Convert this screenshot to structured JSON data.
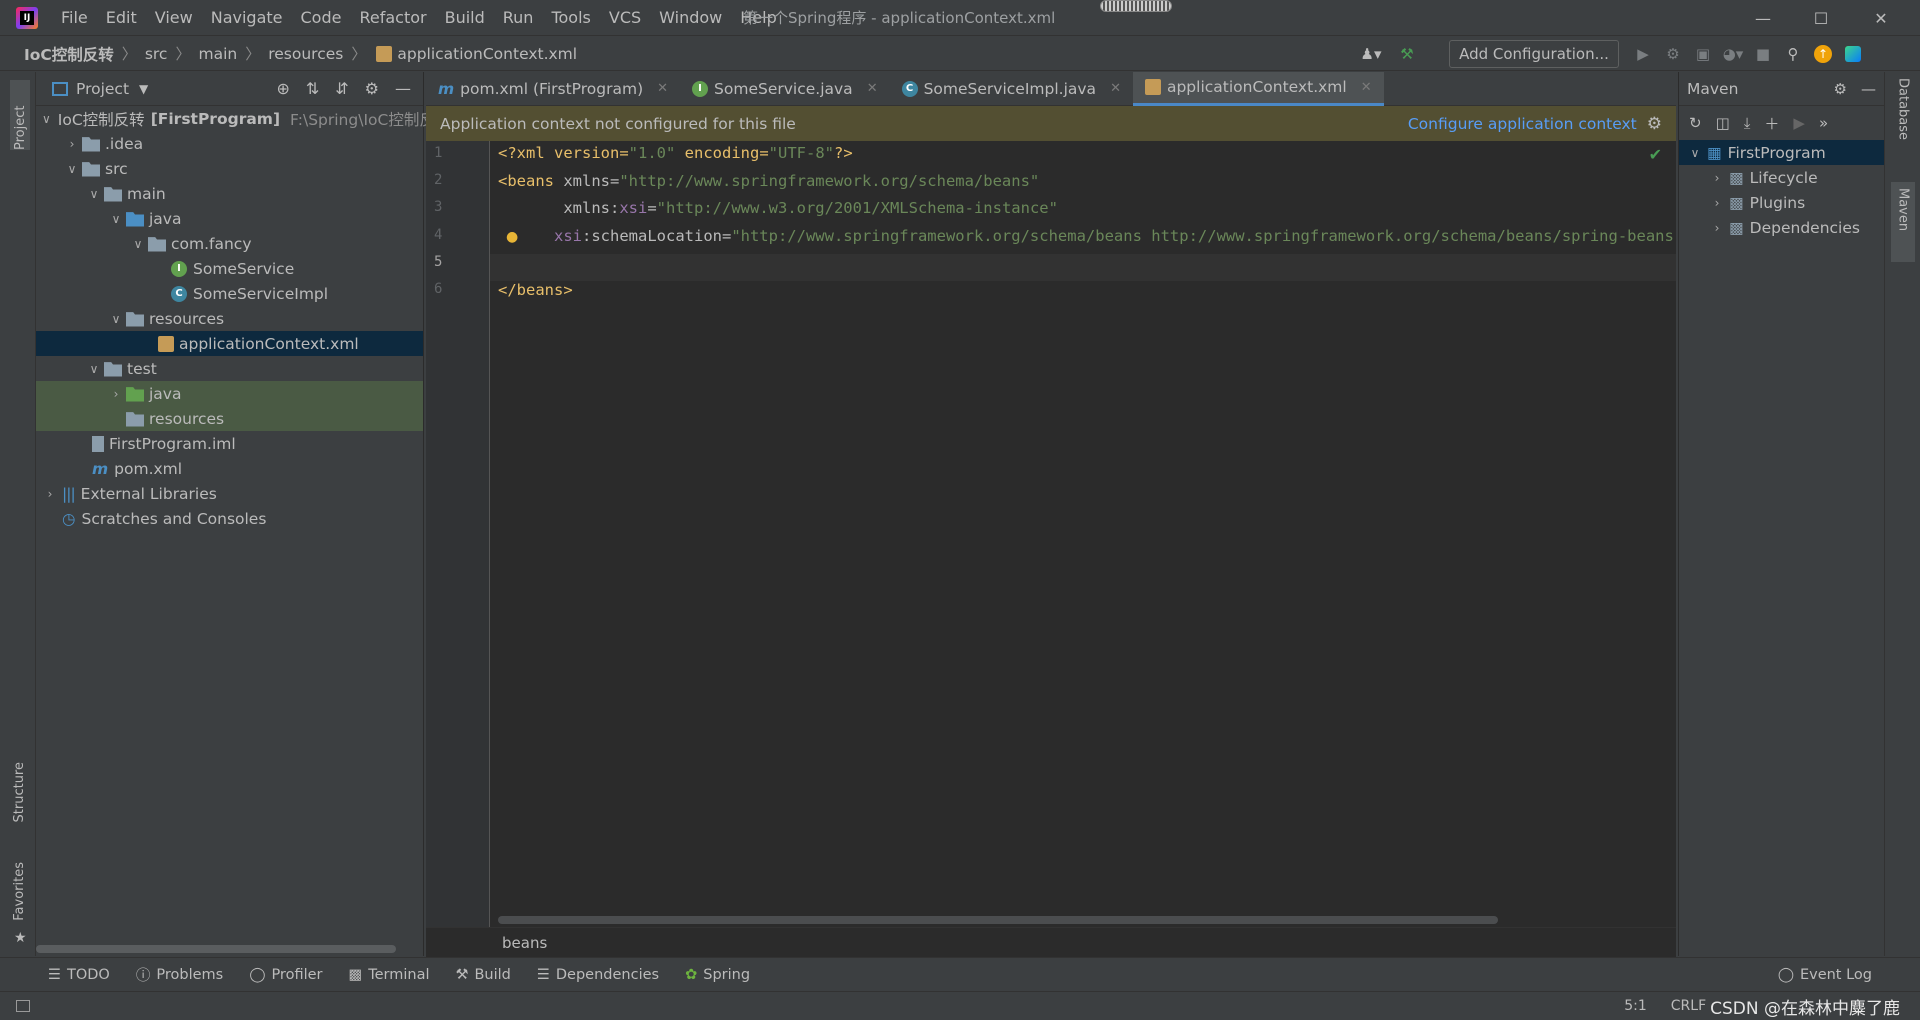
{
  "menu": [
    "File",
    "Edit",
    "View",
    "Navigate",
    "Code",
    "Refactor",
    "Build",
    "Run",
    "Tools",
    "VCS",
    "Window",
    "Help"
  ],
  "window_title": "第一个Spring程序 - applicationContext.xml",
  "breadcrumb": [
    "IoC控制反转",
    "src",
    "main",
    "resources",
    "applicationContext.xml"
  ],
  "toolbar": {
    "add_config": "Add Configuration..."
  },
  "left_stripe": {
    "project": "Project",
    "structure": "Structure",
    "favorites": "Favorites"
  },
  "project": {
    "title": "Project",
    "tree": [
      {
        "label": "IoC控制反转",
        "bold": "[FirstProgram]",
        "path": "F:\\Spring\\IoC控制反"
      },
      {
        "label": ".idea"
      },
      {
        "label": "src"
      },
      {
        "label": "main"
      },
      {
        "label": "java"
      },
      {
        "label": "com.fancy"
      },
      {
        "label": "SomeService"
      },
      {
        "label": "SomeServiceImpl"
      },
      {
        "label": "resources"
      },
      {
        "label": "applicationContext.xml"
      },
      {
        "label": "test"
      },
      {
        "label": "java"
      },
      {
        "label": "resources"
      },
      {
        "label": "FirstProgram.iml"
      },
      {
        "label": "pom.xml"
      },
      {
        "label": "External Libraries"
      },
      {
        "label": "Scratches and Consoles"
      }
    ]
  },
  "tabs": [
    {
      "label": "pom.xml (FirstProgram)",
      "icon": "m"
    },
    {
      "label": "SomeService.java",
      "icon": "I"
    },
    {
      "label": "SomeServiceImpl.java",
      "icon": "C"
    },
    {
      "label": "applicationContext.xml",
      "icon": "xml"
    }
  ],
  "banner": {
    "message": "Application context not configured for this file",
    "action": "Configure application context"
  },
  "code": {
    "line_numbers": [
      "1",
      "2",
      "3",
      "4",
      "5",
      "6"
    ],
    "l1": {
      "a": "<?xml version=",
      "b": "\"1.0\"",
      "c": " encoding=",
      "d": "\"UTF-8\"",
      "e": "?>"
    },
    "l2": {
      "a": "<beans ",
      "b": "xmlns=",
      "c": "\"http://www.springframework.org/schema/beans\""
    },
    "l3": {
      "a": "       xmlns:",
      "b": "xsi",
      "c": "=",
      "d": "\"http://www.w3.org/2001/XMLSchema-instance\""
    },
    "l4": {
      "a": "xsi",
      "b": ":schemaLocation=",
      "c": "\"http://www.springframework.org/schema/beans http://www.springframework.org/schema/beans/spring-beans.xsd\""
    },
    "l6": "</beans>"
  },
  "editor_breadcrumb": "beans",
  "maven": {
    "title": "Maven",
    "root": "FirstProgram",
    "items": [
      "Lifecycle",
      "Plugins",
      "Dependencies"
    ]
  },
  "right_stripe": {
    "database": "Database",
    "maven": "Maven"
  },
  "tool_windows": [
    "TODO",
    "Problems",
    "Profiler",
    "Terminal",
    "Build",
    "Dependencies",
    "Spring"
  ],
  "event_log": "Event Log",
  "status": {
    "position": "5:1",
    "line_sep": "CRLF",
    "watermark": "CSDN @在森林中麋了鹿"
  }
}
